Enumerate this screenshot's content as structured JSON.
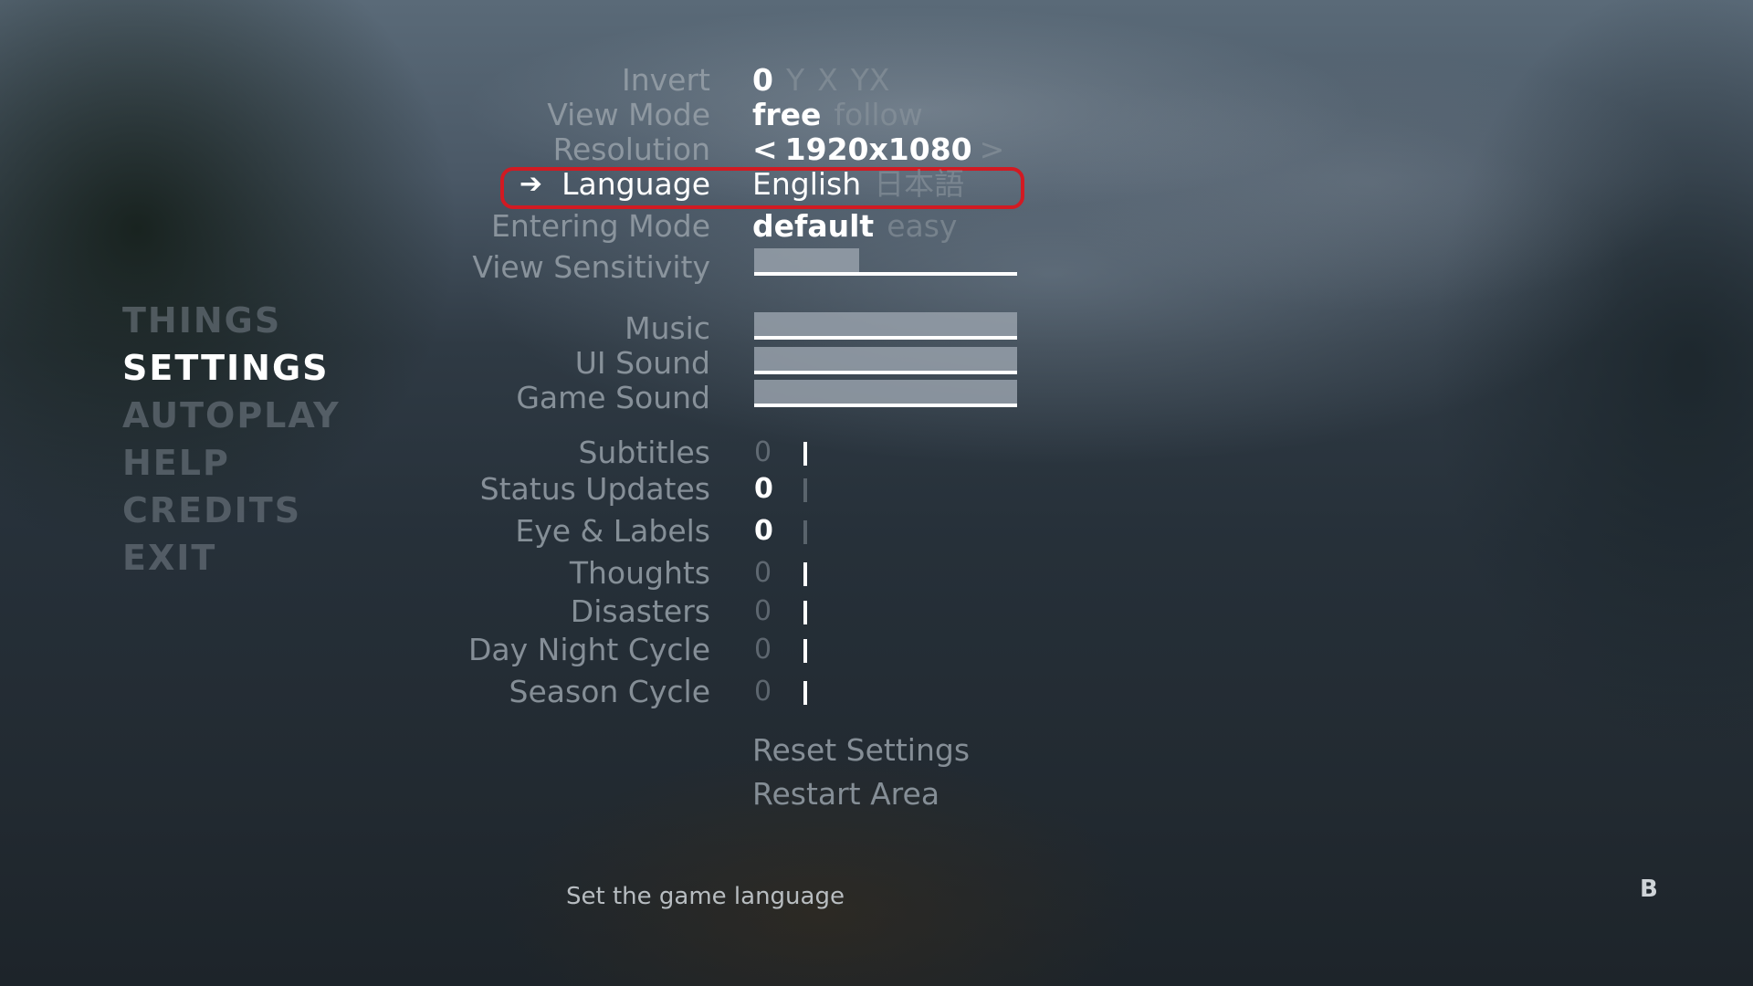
{
  "main_menu": [
    {
      "label": "THINGS"
    },
    {
      "label": "SETTINGS"
    },
    {
      "label": "AUTOPLAY"
    },
    {
      "label": "HELP"
    },
    {
      "label": "CREDITS"
    },
    {
      "label": "EXIT"
    }
  ],
  "settings": {
    "invert": {
      "label": "Invert",
      "options": [
        "0",
        "Y",
        "X",
        "YX"
      ],
      "selected": "0"
    },
    "view_mode": {
      "label": "View Mode",
      "options": [
        "free",
        "follow"
      ],
      "selected": "free"
    },
    "resolution": {
      "label": "Resolution",
      "value": "1920x1080",
      "prev": "<",
      "next": ">"
    },
    "language": {
      "label": "Language",
      "options": [
        "English",
        "日本語"
      ],
      "selected": "English"
    },
    "entering_mode": {
      "label": "Entering Mode",
      "options": [
        "default",
        "easy"
      ],
      "selected": "default"
    },
    "view_sensitivity": {
      "label": "View Sensitivity",
      "level": 0.4
    },
    "music": {
      "label": "Music",
      "level": 1.0
    },
    "ui_sound": {
      "label": "UI Sound",
      "level": 1.0
    },
    "game_sound": {
      "label": "Game Sound",
      "level": 1.0
    },
    "toggles": [
      {
        "label": "Subtitles",
        "off": "0",
        "state": "on"
      },
      {
        "label": "Status Updates",
        "off": "0",
        "state": "off"
      },
      {
        "label": "Eye & Labels",
        "off": "0",
        "state": "off"
      },
      {
        "label": "Thoughts",
        "off": "0",
        "state": "on"
      },
      {
        "label": "Disasters",
        "off": "0",
        "state": "on"
      },
      {
        "label": "Day Night Cycle",
        "off": "0",
        "state": "on"
      },
      {
        "label": "Season Cycle",
        "off": "0",
        "state": "on"
      }
    ],
    "actions": {
      "reset": "Reset Settings",
      "restart": "Restart Area"
    }
  },
  "hint": "Set the game language",
  "back_button": "B",
  "colors": {
    "highlight": "#d21a22",
    "active": "#ffffff",
    "inactive": "#8c969e"
  }
}
